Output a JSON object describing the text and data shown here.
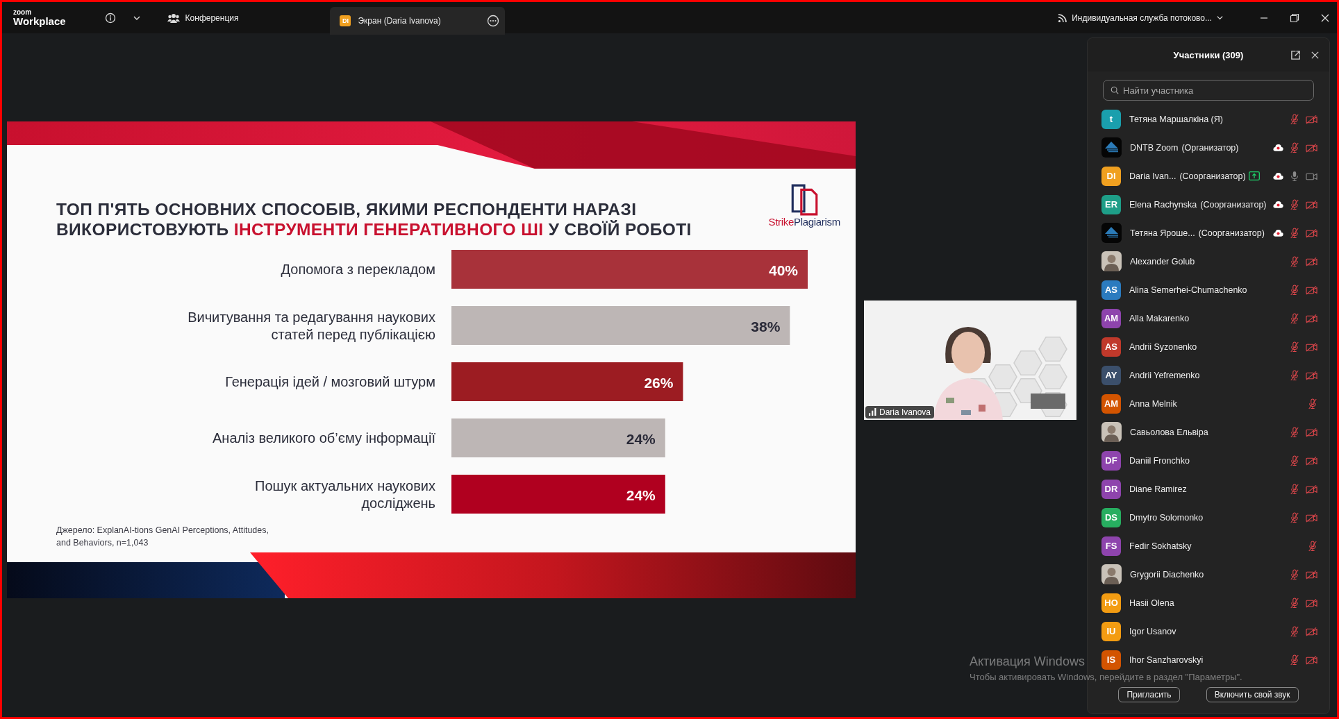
{
  "app": {
    "logo_top": "zoom",
    "logo_bottom": "Workplace"
  },
  "tabs": [
    {
      "kind": "meeting",
      "label": "Конференция",
      "selected": false
    },
    {
      "kind": "share",
      "label": "Экран (Daria Ivanova)",
      "avatar": {
        "initials": "DI",
        "color": "#f0a020"
      },
      "selected": true
    }
  ],
  "stream": {
    "label": "Индивидуальная служба потоково..."
  },
  "slide": {
    "title_lines": [
      [
        {
          "text": "ТОП П'ЯТЬ ОСНОВНИХ СПОСОБІВ, ЯКИМИ РЕСПОНДЕНТИ НАРАЗІ",
          "highlight": false
        }
      ],
      [
        {
          "text": "ВИКОРИСТОВУЮТЬ ",
          "highlight": false
        },
        {
          "text": "ІНСТРУМЕНТИ ГЕНЕРАТИВНОГО ШІ",
          "highlight": true
        },
        {
          "text": " У СВОЇЙ РОБОТІ",
          "highlight": false
        }
      ]
    ],
    "logo": [
      {
        "text": "Strike",
        "color": "#c8102e"
      },
      {
        "text": "Plagiarism",
        "color": "#1f2d5c"
      }
    ],
    "chart_data": {
      "type": "bar",
      "orientation": "horizontal",
      "categories": [
        "Допомога з перекладом",
        "Вичитування та редагування наукових\nстатей перед публікацією",
        "Генерація ідей / мозговий штурм",
        "Аналіз великого об’єму інформації",
        "Пошук актуальних наукових\nдосліджень"
      ],
      "values": [
        40,
        38,
        26,
        24,
        24
      ],
      "xlim": [
        0,
        40
      ],
      "value_labels": [
        "40%",
        "38%",
        "26%",
        "24%",
        "24%"
      ],
      "colors": [
        "#a8323a",
        "#bdb6b5",
        "#9c1c22",
        "#bdb6b5",
        "#b0001f"
      ]
    },
    "source": "Джерело: ExplanAI-tions GenAI Perceptions, Attitudes,\nand Behaviors, n=1,043"
  },
  "video": {
    "name": "Daria Ivanova"
  },
  "participants": {
    "title": "Участники (309)",
    "search": {
      "placeholder": "Найти участника"
    },
    "list": [
      {
        "name": "Тетяна Маршалкіна (Я)",
        "avatar": {
          "kind": "initials",
          "initials": "t",
          "color": "#1a9fad"
        },
        "recording": false,
        "sharing": false,
        "mic_muted": true,
        "camera_on": false
      },
      {
        "name": "DNTB Zoom",
        "role": "(Организатор)",
        "avatar": {
          "kind": "logo"
        },
        "recording": true,
        "sharing": false,
        "mic_muted": true,
        "camera_on": false
      },
      {
        "name": "Daria Ivan...",
        "role": "(Соорганизатор)",
        "avatar": {
          "kind": "initials",
          "initials": "DI",
          "color": "#f0a020"
        },
        "recording": true,
        "sharing": true,
        "mic_muted": false,
        "camera_on": true
      },
      {
        "name": "Elena Rachynska",
        "role": "(Соорганизатор)",
        "avatar": {
          "kind": "initials",
          "initials": "ER",
          "color": "#1e9e88"
        },
        "recording": true,
        "sharing": false,
        "mic_muted": true,
        "camera_on": false
      },
      {
        "name": "Тетяна Ярoше...",
        "role": "(Соорганизатор)",
        "avatar": {
          "kind": "logo"
        },
        "recording": true,
        "sharing": false,
        "mic_muted": true,
        "camera_on": false
      },
      {
        "name": "Alexander Golub",
        "recording": false,
        "sharing": false,
        "mic_muted": true,
        "camera_on": false
      },
      {
        "name": "Alina Semerhei-Chumachenko",
        "avatar": {
          "kind": "initials",
          "initials": "AS",
          "color": "#2b7bbf"
        },
        "recording": false,
        "sharing": false,
        "mic_muted": true,
        "camera_on": false
      },
      {
        "name": "Alla Makarenko",
        "avatar": {
          "kind": "initials",
          "initials": "AM",
          "color": "#8e44ad"
        },
        "recording": false,
        "sharing": false,
        "mic_muted": true,
        "camera_on": false
      },
      {
        "name": "Andrii Syzonenko",
        "avatar": {
          "kind": "initials",
          "initials": "AS",
          "color": "#c0392b"
        },
        "recording": false,
        "sharing": false,
        "mic_muted": true,
        "camera_on": false
      },
      {
        "name": "Andrii Yefremenko",
        "avatar": {
          "kind": "initials",
          "initials": "AY",
          "color": "#3b4f6b"
        },
        "recording": false,
        "sharing": false,
        "mic_muted": true,
        "camera_on": false
      },
      {
        "name": "Anna Melnik",
        "avatar": {
          "kind": "initials",
          "initials": "AM",
          "color": "#d35400"
        },
        "recording": false,
        "sharing": false,
        "mic_muted": true
      },
      {
        "name": "Савьолова Ельвіра",
        "recording": false,
        "sharing": false,
        "mic_muted": true,
        "camera_on": false
      },
      {
        "name": "Daniil Fronchko",
        "avatar": {
          "kind": "initials",
          "initials": "DF",
          "color": "#8e44ad"
        },
        "recording": false,
        "sharing": false,
        "mic_muted": true,
        "camera_on": false
      },
      {
        "name": "Diane Ramirez",
        "avatar": {
          "kind": "initials",
          "initials": "DR",
          "color": "#8e44ad"
        },
        "recording": false,
        "sharing": false,
        "mic_muted": true,
        "camera_on": false
      },
      {
        "name": "Dmytro Solomonko",
        "avatar": {
          "kind": "initials",
          "initials": "DS",
          "color": "#27ae60"
        },
        "recording": false,
        "sharing": false,
        "mic_muted": true,
        "camera_on": false
      },
      {
        "name": "Fedir Sokhatsky",
        "avatar": {
          "kind": "initials",
          "initials": "FS",
          "color": "#8e44ad"
        },
        "recording": false,
        "sharing": false,
        "mic_muted": true
      },
      {
        "name": "Grygorii Diachenko",
        "recording": false,
        "sharing": false,
        "mic_muted": true,
        "camera_on": false
      },
      {
        "name": "Hasii Olena",
        "avatar": {
          "kind": "initials",
          "initials": "HO",
          "color": "#f39c12"
        },
        "recording": false,
        "sharing": false,
        "mic_muted": true,
        "camera_on": false
      },
      {
        "name": "Igor Usanov",
        "avatar": {
          "kind": "initials",
          "initials": "IU",
          "color": "#f39c12"
        },
        "recording": false,
        "sharing": false,
        "mic_muted": true,
        "camera_on": false
      },
      {
        "name": "Ihor Sanzharovskyi",
        "avatar": {
          "kind": "initials",
          "initials": "IS",
          "color": "#d35400"
        },
        "recording": false,
        "sharing": false,
        "mic_muted": true,
        "camera_on": false
      }
    ],
    "buttons": [
      "Пригласить",
      "Включить свой звук"
    ]
  },
  "os_notice": {
    "title": "Активация Windows",
    "text": "Чтобы активировать Windows, перейдите в раздел \"Параметры\"."
  }
}
